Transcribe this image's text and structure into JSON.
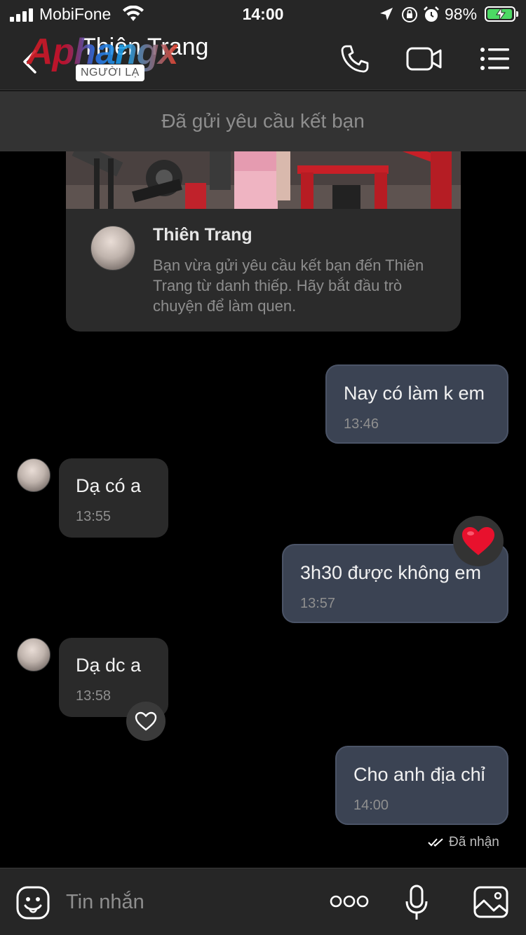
{
  "status_bar": {
    "carrier": "MobiFone",
    "time": "14:00",
    "battery": "98%",
    "battery_level": 0.98
  },
  "header": {
    "contact_name": "Thiên Trang",
    "badge": "NGƯỜI LẠ",
    "watermark": "Aphangx",
    "icons": [
      "back-icon",
      "phone-icon",
      "video-camera-icon",
      "menu-icon"
    ]
  },
  "friend_banner": {
    "text": "Đã gửi yêu cầu kết bạn"
  },
  "card": {
    "name": "Thiên Trang",
    "text": "Bạn vừa gửi yêu cầu kết bạn đến Thiên Trang từ danh thiếp. Hãy bắt đầu trò chuyện để làm quen."
  },
  "messages": [
    {
      "side": "me",
      "text": "Nay có làm k em",
      "time": "13:46"
    },
    {
      "side": "them",
      "text": "Dạ có a",
      "time": "13:55"
    },
    {
      "side": "me",
      "text": "3h30 được không em",
      "time": "13:57",
      "reaction": "heart"
    },
    {
      "side": "them",
      "text": "Dạ dc a",
      "time": "13:58"
    },
    {
      "side": "me",
      "text": "Cho anh địa chỉ",
      "time": "14:00"
    }
  ],
  "delivery_status": "Đã nhận",
  "input_bar": {
    "placeholder": "Tin nhắn",
    "icons": [
      "sticker-icon",
      "more-icon",
      "microphone-icon",
      "image-icon"
    ]
  },
  "colors": {
    "my_bubble": "#3b4353",
    "their_bubble": "#2a2a2a",
    "bars": "#262626",
    "heart": "#e8112d"
  }
}
